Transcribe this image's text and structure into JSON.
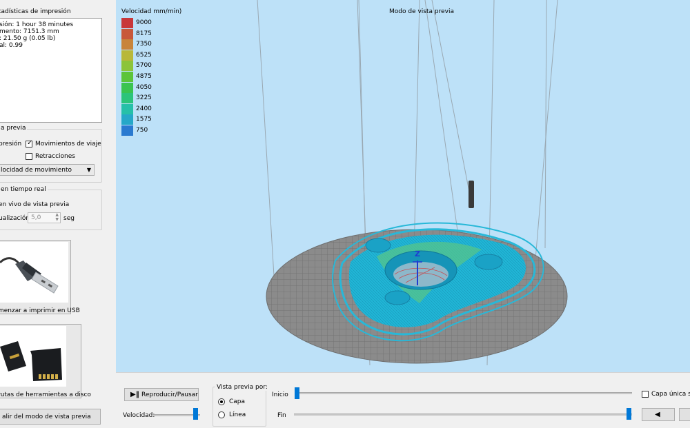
{
  "stats": {
    "title": "tadísticas de impresión",
    "lines": [
      "sión: 1 hour 38 minutes",
      "mento: 7151.3 mm",
      ": 21.50 g (0.05 lb)",
      "al: 0.99"
    ]
  },
  "preview_settings": {
    "title": "a previa",
    "impresion_label": "presión",
    "travel_label": "Movimientos de viaje",
    "travel_checked": true,
    "retractions_label": "Retracciones",
    "retractions_checked": false,
    "color_mode_value": "locidad de movimiento"
  },
  "realtime": {
    "title": "en tiempo real",
    "live_label": "en vivo de vista previa",
    "update_label": "ualización",
    "update_value": "5,0",
    "update_unit": "seg"
  },
  "usb_button": {
    "label": "menzar a imprimir en USB"
  },
  "sd_button": {
    "label": "rutas de herramientas a disco"
  },
  "exit_button": {
    "label": "alir del modo de vista previa"
  },
  "viewport": {
    "title": "Modo de vista previa",
    "axis_label": "Z",
    "legend_title": "Velocidad mm/min)",
    "legend": [
      {
        "value": "9000",
        "color": "#c8373a"
      },
      {
        "value": "8175",
        "color": "#c8583a"
      },
      {
        "value": "7350",
        "color": "#c8843a"
      },
      {
        "value": "6525",
        "color": "#b8b83a"
      },
      {
        "value": "5700",
        "color": "#8cc43a"
      },
      {
        "value": "4875",
        "color": "#5cc43a"
      },
      {
        "value": "4050",
        "color": "#3ac450"
      },
      {
        "value": "3225",
        "color": "#2cc47a"
      },
      {
        "value": "2400",
        "color": "#26c0a8"
      },
      {
        "value": "1575",
        "color": "#26a8c8"
      },
      {
        "value": "750",
        "color": "#2a7ad0"
      }
    ]
  },
  "controls": {
    "play_pause_label": "Reproducir/Pausar",
    "speed_label": "Velocidad:",
    "speed_level": 0.93,
    "preview_by_title": "Vista previa por:",
    "layer_label": "Capa",
    "line_label": "Línea",
    "selected_mode": "layer",
    "start_label": "Inicio",
    "start_position": 0.0,
    "end_label": "Fin",
    "end_position": 1.0,
    "single_layer_label": "Capa única sol",
    "single_layer_checked": false,
    "prev_label": "◀"
  },
  "colors": {
    "accent": "#0078d7",
    "model": "#22b8d8",
    "plate": "#8a8a8a"
  }
}
